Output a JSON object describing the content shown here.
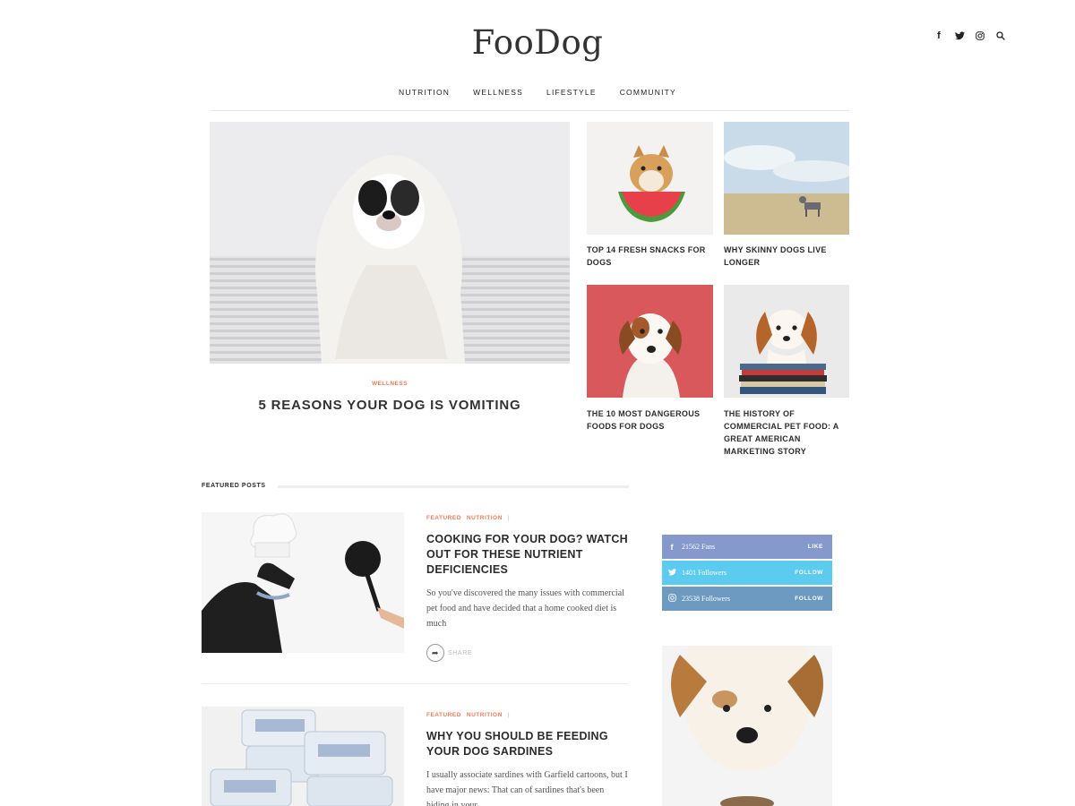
{
  "site": {
    "logo": "FooDog"
  },
  "header_icons": [
    "facebook-icon",
    "twitter-icon",
    "instagram-icon",
    "search-icon"
  ],
  "nav": {
    "items": [
      "NUTRITION",
      "WELLNESS",
      "LIFESTYLE",
      "COMMUNITY"
    ]
  },
  "hero": {
    "category": "WELLNESS",
    "title": "5 REASONS YOUR DOG IS VOMITING"
  },
  "grid": [
    {
      "title": "TOP 14 FRESH SNACKS FOR DOGS"
    },
    {
      "title": "WHY SKINNY DOGS LIVE LONGER"
    },
    {
      "title": "THE 10 MOST DANGEROUS FOODS FOR DOGS"
    },
    {
      "title": "THE HISTORY OF COMMERCIAL PET FOOD: A GREAT AMERICAN MARKETING STORY"
    }
  ],
  "featured": {
    "heading": "FEATURED POSTS",
    "posts": [
      {
        "cat1": "FEATURED",
        "cat2": "NUTRITION",
        "divider": "|",
        "title": "COOKING FOR YOUR DOG? WATCH OUT FOR THESE NUTRIENT DEFICIENCIES",
        "excerpt": "So you've discovered the many issues with commercial pet food and have decided that a home cooked diet is much",
        "share": "SHARE"
      },
      {
        "cat1": "FEATURED",
        "cat2": "NUTRITION",
        "divider": "|",
        "title": "WHY YOU SHOULD BE FEEDING YOUR DOG SARDINES",
        "excerpt": "I usually associate sardines with Garfield cartoons, but I have major news: That can of sardines that's been hiding in your"
      }
    ]
  },
  "social_widget": [
    {
      "icon": "facebook-icon",
      "count": "21562 Fans",
      "action": "LIKE",
      "color": "#8599cc"
    },
    {
      "icon": "twitter-icon",
      "count": "1401 Followers",
      "action": "FOLLOW",
      "color": "#5bcbef"
    },
    {
      "icon": "instagram-icon",
      "count": "23538 Followers",
      "action": "FOLLOW",
      "color": "#6d9ac0"
    }
  ],
  "colors": {
    "accent": "#f07b5a",
    "text": "#2b2b2b"
  }
}
